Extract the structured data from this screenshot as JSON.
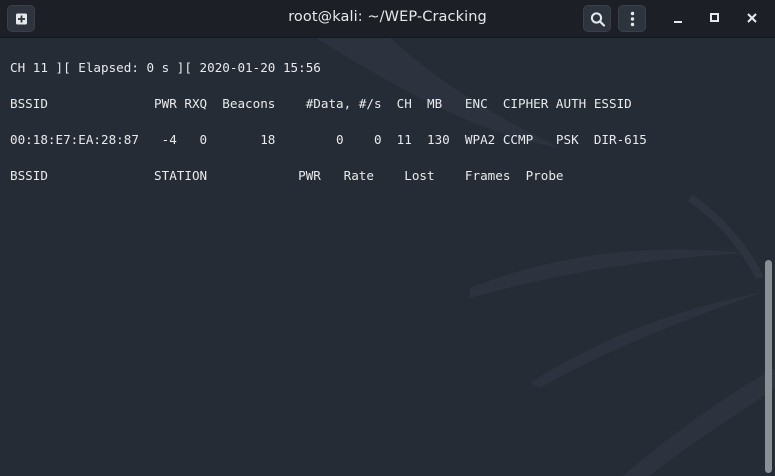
{
  "window": {
    "title": "root@kali: ~/WEP-Cracking",
    "controls": {
      "new_tab_icon": "new-tab-icon",
      "search_icon": "search-icon",
      "menu_icon": "kebab-menu-icon",
      "minimize_icon": "minimize-icon",
      "maximize_icon": "maximize-icon",
      "close_icon": "close-icon"
    }
  },
  "terminal": {
    "status_line": "CH 11 ][ Elapsed: 0 s ][ 2020-01-20 15:56",
    "ap_header": "BSSID              PWR RXQ  Beacons    #Data, #/s  CH  MB   ENC  CIPHER AUTH ESSID",
    "ap_rows": [
      "00:18:E7:EA:28:87   -4   0       18        0    0  11  130  WPA2 CCMP   PSK  DIR-615"
    ],
    "station_header": "BSSID              STATION            PWR   Rate    Lost    Frames  Probe"
  },
  "colors": {
    "titlebar_bg": "#1c2026",
    "terminal_bg": "#262c36",
    "text": "#e8eaed",
    "scrollbar_thumb": "#8a8f96"
  }
}
